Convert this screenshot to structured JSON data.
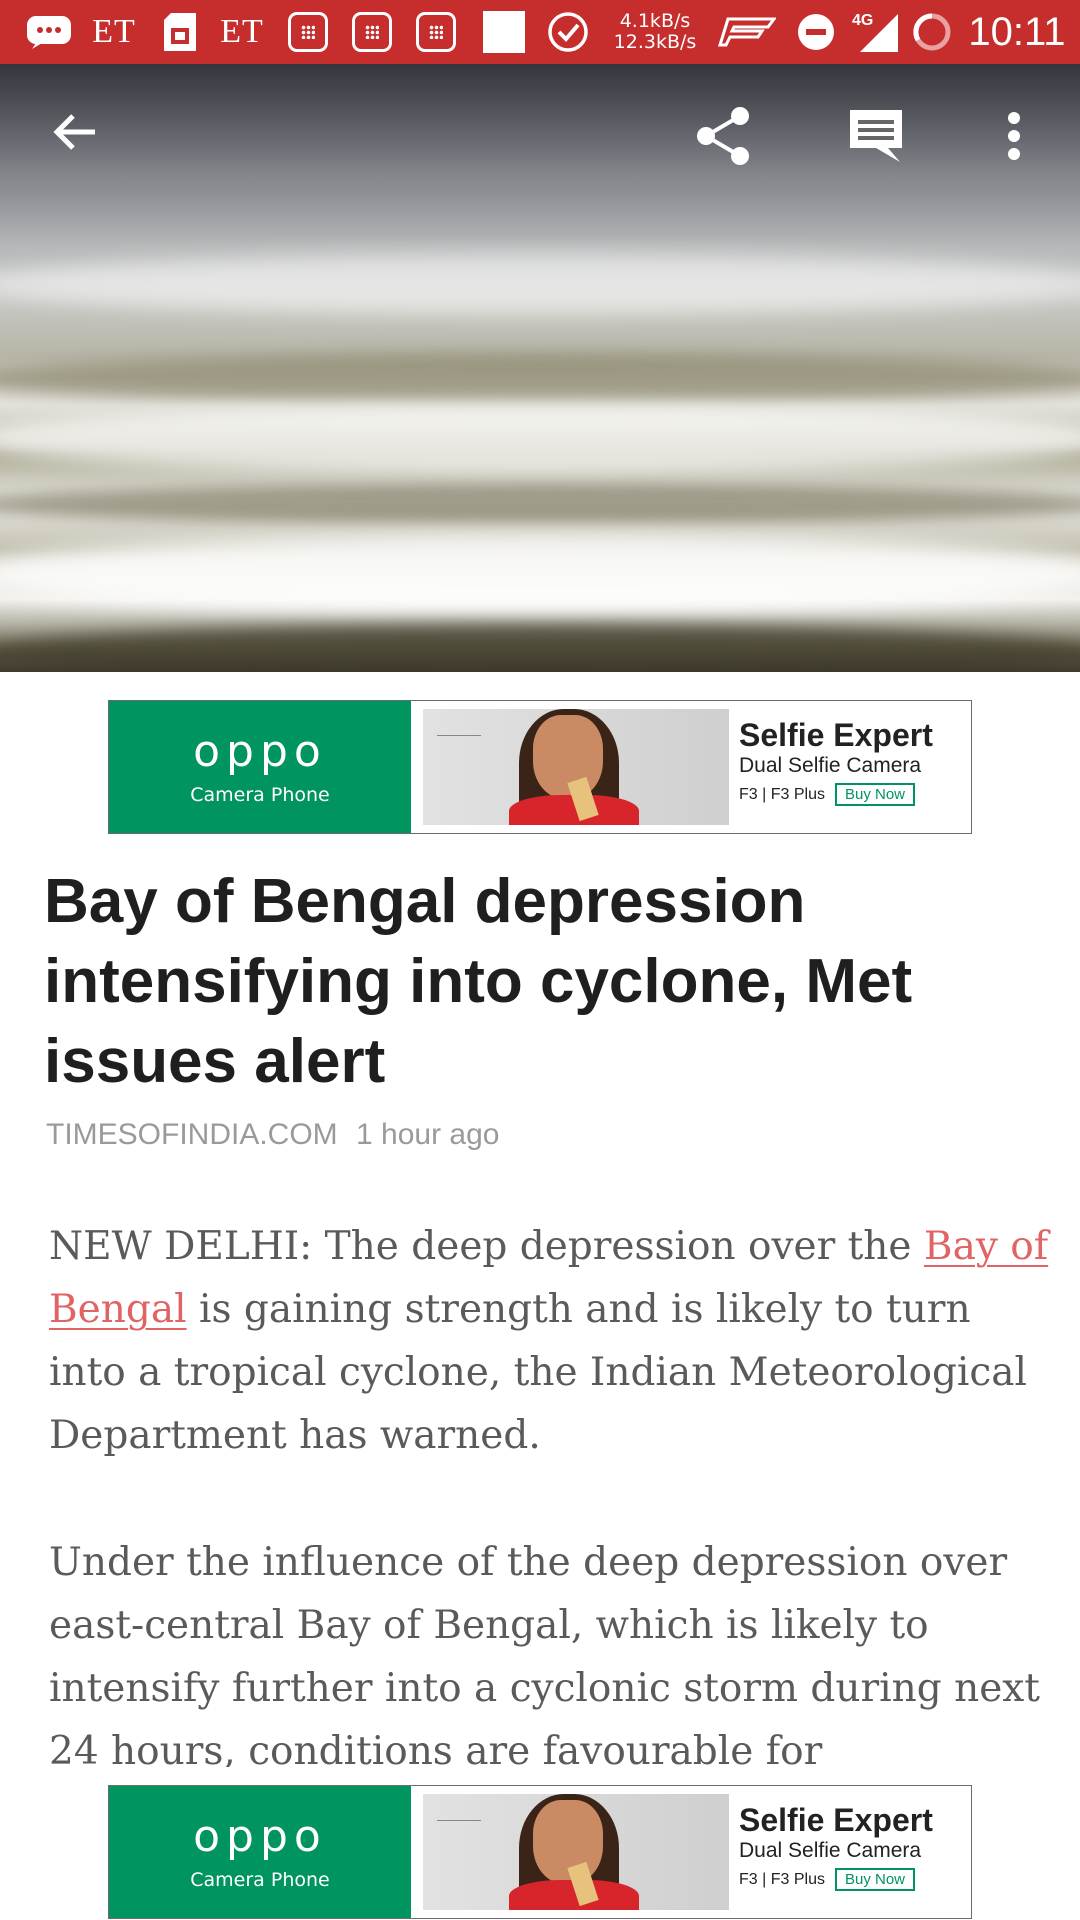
{
  "status_bar": {
    "left_labels": [
      "ET",
      "ET"
    ],
    "network_speed": {
      "up": "4.1kB/s",
      "down": "12.3kB/s"
    },
    "network_type": "4G",
    "time": "10:11",
    "icons": [
      "message-icon",
      "sd-card-icon",
      "calculator-icon",
      "checkmark-circle-icon",
      "signal-icon",
      "do-not-disturb-icon",
      "battery-icon"
    ]
  },
  "toolbar": {
    "icons": [
      "back-arrow-icon",
      "share-icon",
      "comment-icon",
      "more-vert-icon"
    ]
  },
  "ad": {
    "brand": "oppo",
    "brand_subtitle": "Camera Phone",
    "headline": "Selfie Expert",
    "tagline": "Dual Selfie Camera",
    "models": "F3 | F3 Plus",
    "cta": "Buy Now",
    "colors": {
      "brand": "#00945f"
    }
  },
  "article": {
    "headline": "Bay of Bengal depression intensifying into cyclone, Met issues alert",
    "source": "TIMESOFINDIA.COM",
    "time_ago": "1 hour ago",
    "paragraph1": {
      "lead": "NEW DELHI: The deep depression over the",
      "link": "Bay of Bengal",
      "rest": "is gaining strength and is likely to turn into a tropical cyclone, the Indian Meteorological Department has warned."
    },
    "paragraph2": "Under the influence of the deep depression over east-central Bay of Bengal, which is likely to intensify further into a cyclonic storm during next 24 hours, conditions are favourable for"
  },
  "colors": {
    "status_bar": "#c62d2d",
    "link": "#e06464",
    "headline": "#1f1f1f",
    "meta": "#9a9a9a",
    "body": "#5a5a5a"
  }
}
